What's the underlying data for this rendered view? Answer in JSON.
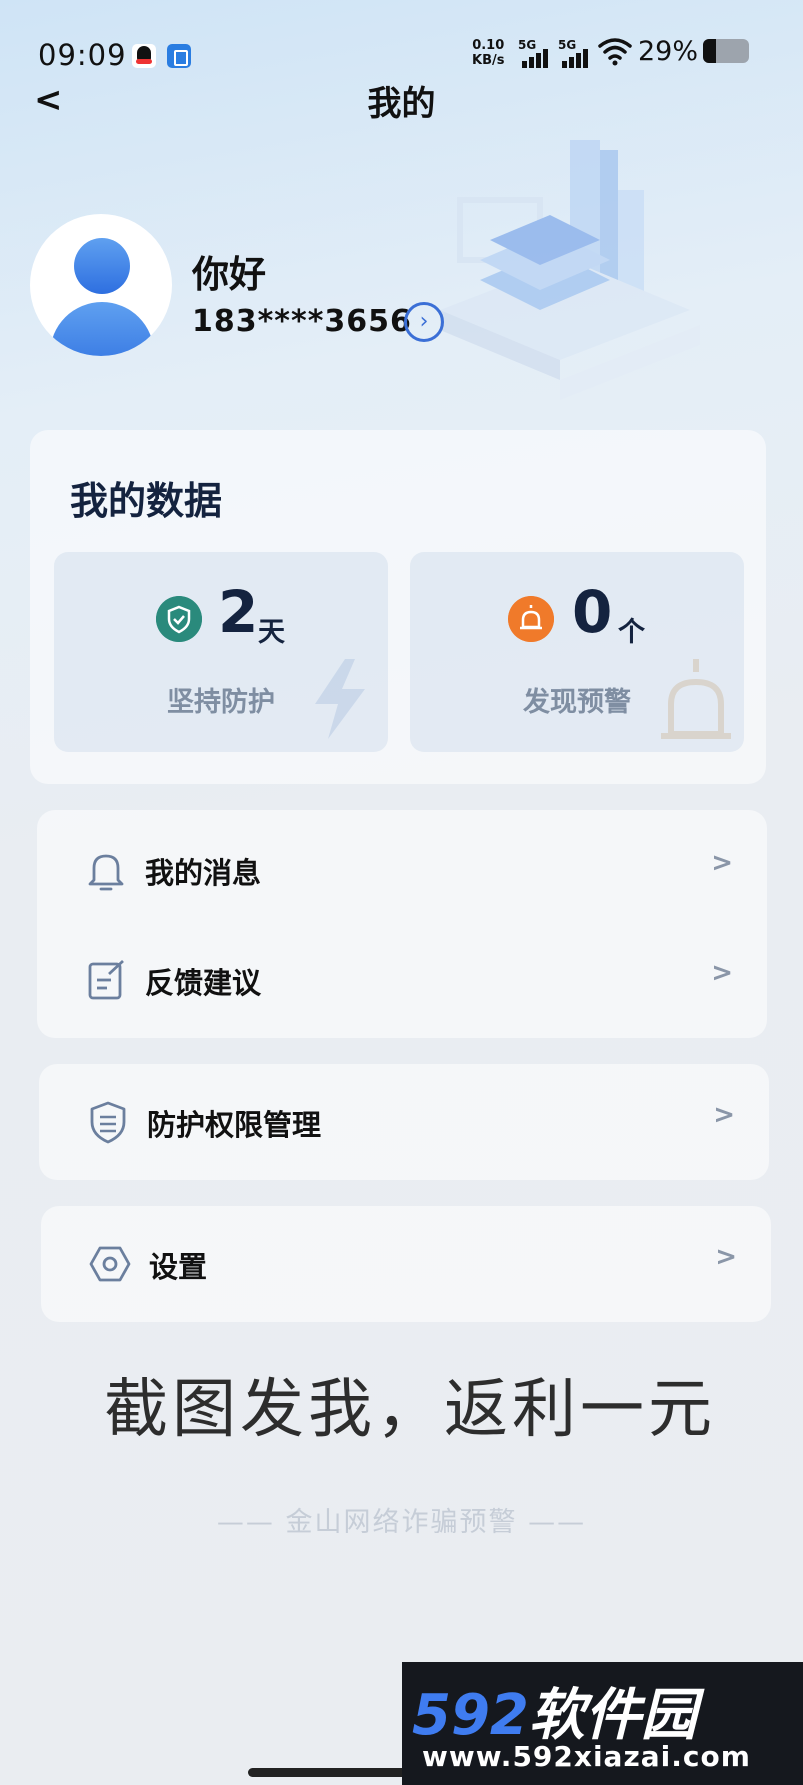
{
  "status_bar": {
    "time": "09:09",
    "net_speed_value": "0.10",
    "net_speed_unit": "KB/s",
    "signal_1_label": "5G",
    "signal_2_label": "5G",
    "battery": "29%",
    "battery_level": 0.29,
    "icons": [
      "qq-icon",
      "app-icon",
      "wifi-icon",
      "battery-icon"
    ]
  },
  "header": {
    "back": "<",
    "title": "我的"
  },
  "profile": {
    "greeting": "你好",
    "phone": "183****3656",
    "arrow": "›"
  },
  "my_data": {
    "title": "我的数据",
    "stats": [
      {
        "value": "2",
        "unit": "天",
        "label": "坚持防护",
        "icon": "shield-check-icon",
        "icon_color": "#2a8a7c"
      },
      {
        "value": "0",
        "unit": "个",
        "label": "发现预警",
        "icon": "alarm-icon",
        "icon_color": "#f07a2a"
      }
    ]
  },
  "menu": {
    "group1": [
      {
        "label": "我的消息",
        "icon": "bell-icon",
        "chevron": ">"
      },
      {
        "label": "反馈建议",
        "icon": "edit-note-icon",
        "chevron": ">"
      }
    ],
    "group2": [
      {
        "label": "防护权限管理",
        "icon": "shield-settings-icon",
        "chevron": ">"
      }
    ],
    "group3": [
      {
        "label": "设置",
        "icon": "hex-gear-icon",
        "chevron": ">"
      }
    ]
  },
  "overlay_text": "截图发我，返利一元",
  "footer_brand": "—— 金山网络诈骗预警 ——",
  "watermark": {
    "logo_number": "592",
    "logo_text": "软件园",
    "url": "www.592xiazai.com"
  },
  "colors": {
    "accent": "#3b6fd6",
    "title_text": "#14233f",
    "muted_text": "#7f8ea2"
  }
}
